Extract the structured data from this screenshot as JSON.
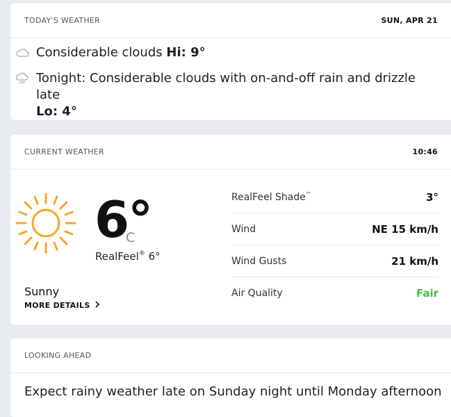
{
  "today": {
    "title": "TODAY'S WEATHER",
    "date": "SUN, APR 21",
    "day_phrase": "Considerable clouds",
    "hi_label": "Hi: 9°",
    "night_phrase": "Tonight: Considerable clouds with on-and-off rain and drizzle late",
    "lo_label": "Lo: 4°",
    "day_icon": "cloud-icon",
    "night_icon": "rain-cloud-icon"
  },
  "current": {
    "title": "CURRENT WEATHER",
    "time": "10:46",
    "temp": "6°",
    "unit": "C",
    "realfeel_label": "RealFeel",
    "realfeel_mark": "®",
    "realfeel_value": "6°",
    "phrase": "Sunny",
    "more_details": "MORE DETAILS",
    "icon": "sun-icon",
    "details": [
      {
        "label": "RealFeel Shade",
        "mark": "™",
        "value": "3°"
      },
      {
        "label": "Wind",
        "mark": "",
        "value": "NE 15 km/h"
      },
      {
        "label": "Wind Gusts",
        "mark": "",
        "value": "21 km/h"
      },
      {
        "label": "Air Quality",
        "mark": "",
        "value": "Fair"
      }
    ],
    "fair_color": "#45c149"
  },
  "ahead": {
    "title": "LOOKING AHEAD",
    "text": "Expect rainy weather late on Sunday night until Monday afternoon"
  }
}
